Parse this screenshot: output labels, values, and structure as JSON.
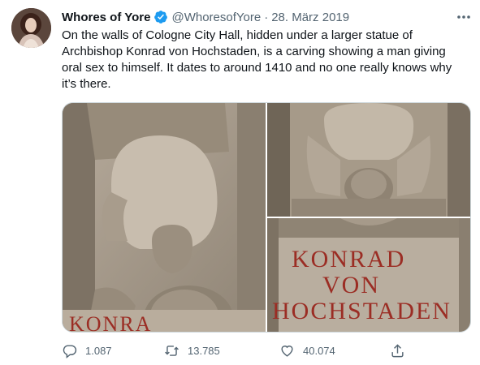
{
  "tweet": {
    "author_name": "Whores of Yore",
    "handle": "@WhoresofYore",
    "separator": "·",
    "date": "28. März 2019",
    "text": "On the walls of Cologne City Hall, hidden under a larger statue of Archbishop Konrad von Hochstaden,  is a carving showing a man giving oral sex to himself. It dates to around 1410 and no one really knows why it’s there.",
    "media": {
      "left_image_caption": "KONRA",
      "bottom_right_lines": [
        "KONRAD",
        "VON",
        "HOCHSTADEN"
      ]
    },
    "actions": {
      "replies": "1.087",
      "retweets": "13.785",
      "likes": "40.074"
    }
  },
  "icons": {
    "verified": "verified-badge-icon",
    "more": "more-icon",
    "reply": "reply-icon",
    "retweet": "retweet-icon",
    "like": "heart-icon",
    "share": "share-icon"
  },
  "colors": {
    "text_primary": "#0f1419",
    "text_secondary": "#536471",
    "verified_blue": "#1d9bf0",
    "stone_red": "#9b2d24"
  }
}
